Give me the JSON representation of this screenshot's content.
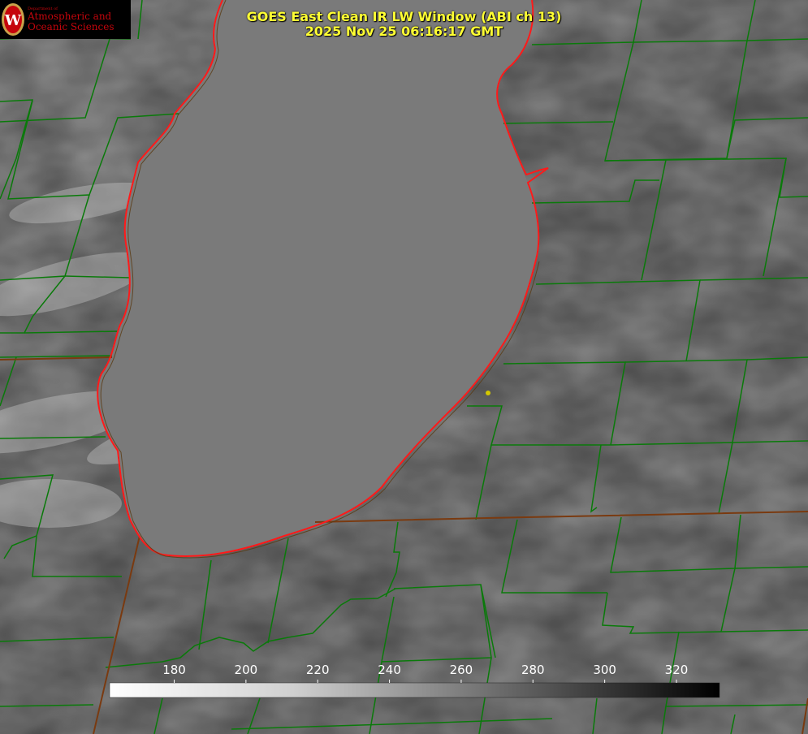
{
  "title_line1": "GOES East Clean IR LW Window (ABI ch 13)",
  "title_line2": "2025 Nov 25 06:16:17 GMT",
  "logo": {
    "line_small": "Department of",
    "line_main": "Atmospheric and Oceanic Sciences",
    "letter": "W"
  },
  "colorbar": {
    "ticks": [
      "180",
      "200",
      "220",
      "240",
      "260",
      "280",
      "300",
      "320"
    ],
    "min": 162,
    "max": 332,
    "tick_values": [
      180,
      200,
      220,
      240,
      260,
      280,
      300,
      320
    ]
  },
  "colors": {
    "county_lines": "#0a7a0a",
    "shoreline": "#ff1a1a",
    "title": "#ffff33",
    "marker": "#d4c800"
  }
}
